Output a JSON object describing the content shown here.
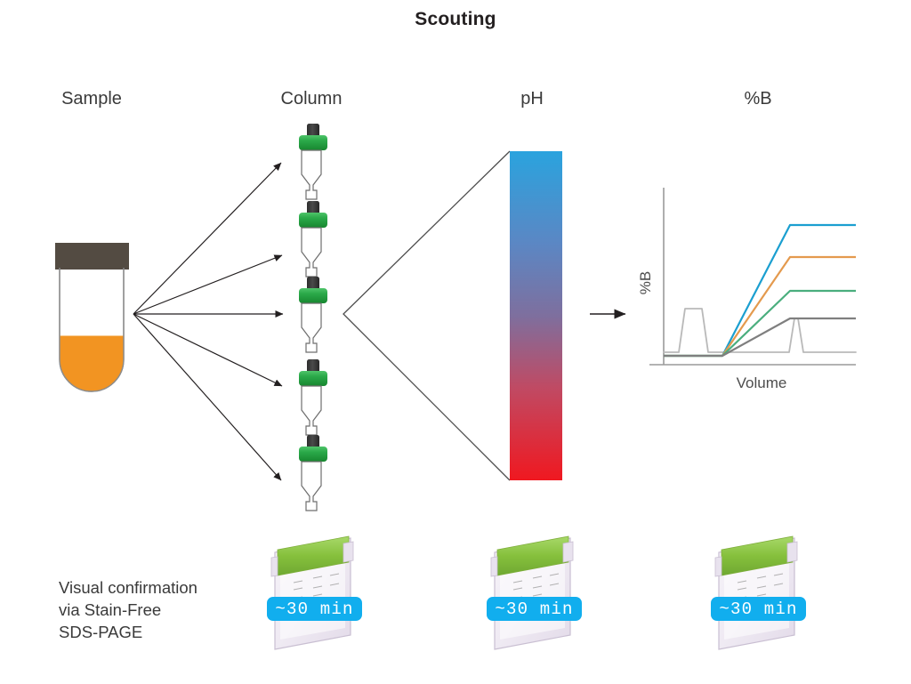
{
  "title": "Scouting",
  "stages": [
    {
      "id": "sample",
      "label": "Sample"
    },
    {
      "id": "column",
      "label": "Column"
    },
    {
      "id": "ph",
      "label": "pH"
    },
    {
      "id": "pctb",
      "label": "%B"
    }
  ],
  "sample": {
    "cap_color": "#534b42",
    "liquid_color": "#f29422",
    "body_outline": "#8c8c8c",
    "fill_fraction": 0.46
  },
  "columns": {
    "count": 5,
    "collar_color": "#2baa4a",
    "collar_color_dark": "#13832f",
    "stem_color": "#3a3a3a",
    "outline_color": "#6e6e6e"
  },
  "arrows": {
    "count": 5,
    "color": "#231f20",
    "origin_label": "sample-outlet"
  },
  "ph_bar": {
    "top_color": "#2aa3de",
    "mid_color": "#7e6f9e",
    "bottom_color": "#f01820",
    "top_label": "",
    "bottom_label": ""
  },
  "funnel": {
    "stroke": "#4d4d4d",
    "apex_side": "left"
  },
  "transition_arrow": {
    "color": "#231f20",
    "direction": "right"
  },
  "chart_data": {
    "type": "line",
    "title": "",
    "xlabel": "Volume",
    "ylabel": "%B",
    "xlim": [
      0,
      100
    ],
    "ylim": [
      0,
      100
    ],
    "grid": false,
    "legend": "none",
    "axis_color": "#9a9a9a",
    "gradient_start_x": 33,
    "series": [
      {
        "name": "gradient-1",
        "color": "#1b9fd0",
        "start": [
          33,
          2
        ],
        "knee": [
          72,
          83
        ],
        "end": [
          100,
          83
        ]
      },
      {
        "name": "gradient-2",
        "color": "#e49a4e",
        "start": [
          33,
          2
        ],
        "knee": [
          72,
          62
        ],
        "end": [
          100,
          62
        ]
      },
      {
        "name": "gradient-3",
        "color": "#4aae7e",
        "start": [
          33,
          2
        ],
        "knee": [
          72,
          41
        ],
        "end": [
          100,
          41
        ]
      },
      {
        "name": "gradient-4",
        "color": "#7f7f7f",
        "start": [
          33,
          2
        ],
        "knee": [
          72,
          23
        ],
        "end": [
          100,
          23
        ]
      }
    ],
    "chromatogram": {
      "name": "uv-trace",
      "color": "#b9b9b9",
      "baseline": 4,
      "peaks": [
        {
          "name": "peak-1",
          "start": 8,
          "rise_end": 13,
          "fall_start": 23,
          "end": 28,
          "height": 31
        },
        {
          "name": "peak-2",
          "start": 61,
          "rise_end": 66,
          "fall_start": 68,
          "end": 73,
          "height": 34
        }
      ]
    }
  },
  "gel_section": {
    "caption_lines": [
      "Visual confirmation",
      "via Stain-Free",
      "SDS-PAGE"
    ],
    "gels": [
      {
        "id": "gel-1",
        "time_label": "~30 min"
      },
      {
        "id": "gel-2",
        "time_label": "~30 min"
      },
      {
        "id": "gel-3",
        "time_label": "~30 min"
      }
    ],
    "gel_colors": {
      "comb": "#8cc63f",
      "plastic": "#efeaf3",
      "plastic_edge": "#c9bfd2",
      "band": "#9a9a9a"
    },
    "badge_color": "#11aeee",
    "badge_text_color": "#ffffff"
  }
}
